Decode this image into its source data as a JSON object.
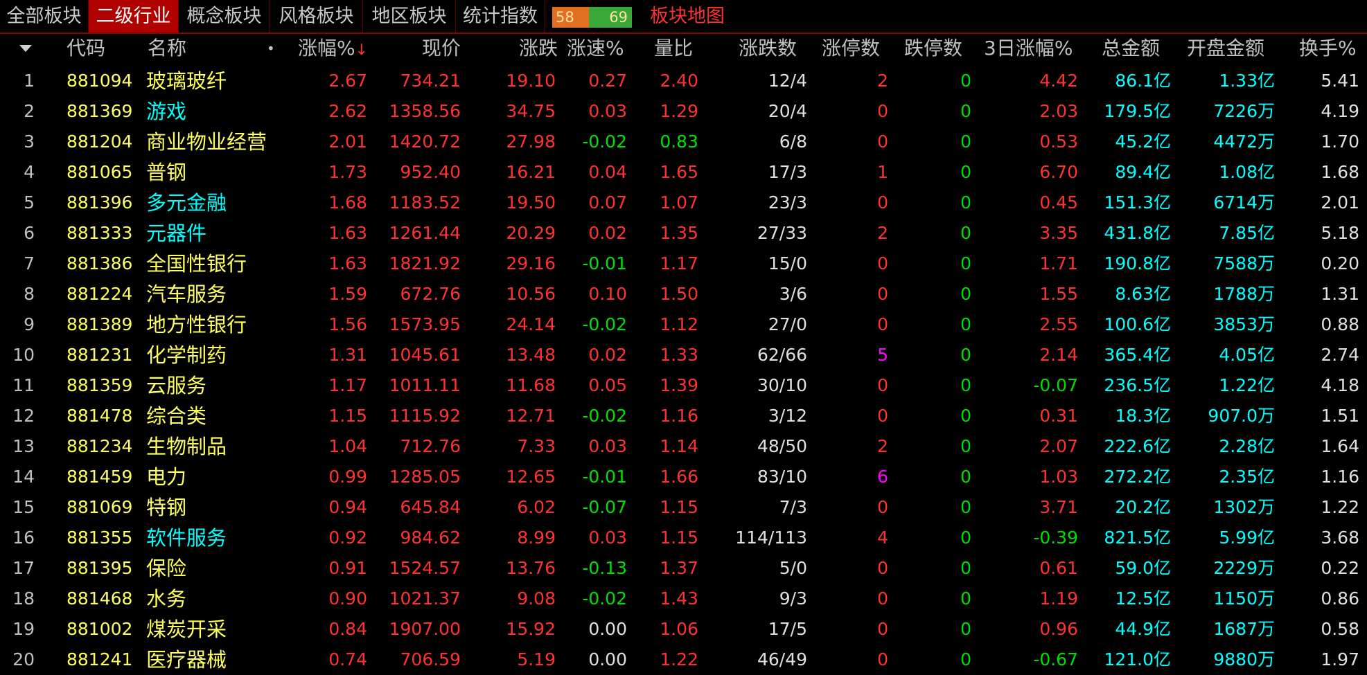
{
  "tabs": [
    {
      "label": "全部板块",
      "active": false
    },
    {
      "label": "二级行业",
      "active": true
    },
    {
      "label": "概念板块",
      "active": false
    },
    {
      "label": "风格板块",
      "active": false
    },
    {
      "label": "地区板块",
      "active": false
    },
    {
      "label": "统计指数",
      "active": false
    }
  ],
  "ratio": {
    "up": "58",
    "down": "69",
    "up_fraction": 0.457
  },
  "map_label": "板块地图",
  "headers": {
    "code": "代码",
    "name": "名称",
    "dot": "•",
    "pct": "涨幅%",
    "pct_sort": "↓",
    "price": "现价",
    "change": "涨跌",
    "speed": "涨速%",
    "vol_ratio": "量比",
    "updown": "涨跌数",
    "limit_up": "涨停数",
    "limit_down": "跌停数",
    "pct3": "3日涨幅%",
    "amount": "总金额",
    "open_amount": "开盘金额",
    "turnover": "换手%"
  },
  "colors": {
    "red": "#ff3232",
    "green": "#00e000",
    "cyan": "#00ffff",
    "yellow": "#ffff60",
    "tab_active": "#b00000"
  },
  "rows": [
    {
      "idx": "1",
      "code": "881094",
      "name": "玻璃玻纤",
      "name_color": "yellow",
      "pct": "2.67",
      "price": "734.21",
      "change": "19.10",
      "speed": "0.27",
      "vol_ratio": "2.40",
      "updown": "12/4",
      "limit_up": "2",
      "limit_up_color": "red",
      "limit_down": "0",
      "pct3": "4.42",
      "amount": "86.1亿",
      "open_amount": "1.33亿",
      "turnover": "5.41"
    },
    {
      "idx": "2",
      "code": "881369",
      "name": "游戏",
      "name_color": "cyan",
      "pct": "2.62",
      "price": "1358.56",
      "change": "34.75",
      "speed": "0.03",
      "vol_ratio": "1.29",
      "updown": "20/4",
      "limit_up": "0",
      "limit_up_color": "red",
      "limit_down": "0",
      "pct3": "2.03",
      "amount": "179.5亿",
      "open_amount": "7226万",
      "turnover": "4.19"
    },
    {
      "idx": "3",
      "code": "881204",
      "name": "商业物业经营",
      "name_color": "yellow",
      "pct": "2.01",
      "price": "1420.72",
      "change": "27.98",
      "speed": "-0.02",
      "vol_ratio": "0.83",
      "updown": "6/8",
      "limit_up": "0",
      "limit_up_color": "red",
      "limit_down": "0",
      "pct3": "0.53",
      "amount": "45.2亿",
      "open_amount": "4472万",
      "turnover": "1.70"
    },
    {
      "idx": "4",
      "code": "881065",
      "name": "普钢",
      "name_color": "yellow",
      "pct": "1.73",
      "price": "952.40",
      "change": "16.21",
      "speed": "0.04",
      "vol_ratio": "1.65",
      "updown": "17/3",
      "limit_up": "1",
      "limit_up_color": "red",
      "limit_down": "0",
      "pct3": "6.70",
      "amount": "89.4亿",
      "open_amount": "1.08亿",
      "turnover": "1.68"
    },
    {
      "idx": "5",
      "code": "881396",
      "name": "多元金融",
      "name_color": "cyan",
      "pct": "1.68",
      "price": "1183.52",
      "change": "19.50",
      "speed": "0.07",
      "vol_ratio": "1.07",
      "updown": "23/3",
      "limit_up": "0",
      "limit_up_color": "red",
      "limit_down": "0",
      "pct3": "0.45",
      "amount": "151.3亿",
      "open_amount": "6714万",
      "turnover": "2.01"
    },
    {
      "idx": "6",
      "code": "881333",
      "name": "元器件",
      "name_color": "cyan",
      "pct": "1.63",
      "price": "1261.44",
      "change": "20.29",
      "speed": "0.02",
      "vol_ratio": "1.35",
      "updown": "27/33",
      "limit_up": "2",
      "limit_up_color": "red",
      "limit_down": "0",
      "pct3": "3.35",
      "amount": "431.8亿",
      "open_amount": "7.85亿",
      "turnover": "5.18"
    },
    {
      "idx": "7",
      "code": "881386",
      "name": "全国性银行",
      "name_color": "yellow",
      "pct": "1.63",
      "price": "1821.92",
      "change": "29.16",
      "speed": "-0.01",
      "vol_ratio": "1.17",
      "updown": "15/0",
      "limit_up": "0",
      "limit_up_color": "red",
      "limit_down": "0",
      "pct3": "1.71",
      "amount": "190.8亿",
      "open_amount": "7588万",
      "turnover": "0.20"
    },
    {
      "idx": "8",
      "code": "881224",
      "name": "汽车服务",
      "name_color": "yellow",
      "pct": "1.59",
      "price": "672.76",
      "change": "10.56",
      "speed": "0.10",
      "vol_ratio": "1.50",
      "updown": "3/6",
      "limit_up": "0",
      "limit_up_color": "red",
      "limit_down": "0",
      "pct3": "1.55",
      "amount": "8.63亿",
      "open_amount": "1788万",
      "turnover": "1.31"
    },
    {
      "idx": "9",
      "code": "881389",
      "name": "地方性银行",
      "name_color": "yellow",
      "pct": "1.56",
      "price": "1573.95",
      "change": "24.14",
      "speed": "-0.02",
      "vol_ratio": "1.12",
      "updown": "27/0",
      "limit_up": "0",
      "limit_up_color": "red",
      "limit_down": "0",
      "pct3": "2.55",
      "amount": "100.6亿",
      "open_amount": "3853万",
      "turnover": "0.88"
    },
    {
      "idx": "10",
      "code": "881231",
      "name": "化学制药",
      "name_color": "yellow",
      "pct": "1.31",
      "price": "1045.61",
      "change": "13.48",
      "speed": "0.02",
      "vol_ratio": "1.33",
      "updown": "62/66",
      "limit_up": "5",
      "limit_up_color": "magenta",
      "limit_down": "0",
      "pct3": "2.14",
      "amount": "365.4亿",
      "open_amount": "4.05亿",
      "turnover": "2.74"
    },
    {
      "idx": "11",
      "code": "881359",
      "name": "云服务",
      "name_color": "yellow",
      "pct": "1.17",
      "price": "1011.11",
      "change": "11.68",
      "speed": "0.05",
      "vol_ratio": "1.39",
      "updown": "30/10",
      "limit_up": "0",
      "limit_up_color": "red",
      "limit_down": "0",
      "pct3": "-0.07",
      "amount": "236.5亿",
      "open_amount": "1.22亿",
      "turnover": "4.18"
    },
    {
      "idx": "12",
      "code": "881478",
      "name": "综合类",
      "name_color": "yellow",
      "pct": "1.15",
      "price": "1115.92",
      "change": "12.71",
      "speed": "-0.02",
      "vol_ratio": "1.16",
      "updown": "3/12",
      "limit_up": "0",
      "limit_up_color": "red",
      "limit_down": "0",
      "pct3": "0.31",
      "amount": "18.3亿",
      "open_amount": "907.0万",
      "turnover": "1.51"
    },
    {
      "idx": "13",
      "code": "881234",
      "name": "生物制品",
      "name_color": "yellow",
      "pct": "1.04",
      "price": "712.76",
      "change": "7.33",
      "speed": "0.03",
      "vol_ratio": "1.14",
      "updown": "48/50",
      "limit_up": "2",
      "limit_up_color": "red",
      "limit_down": "0",
      "pct3": "2.07",
      "amount": "222.6亿",
      "open_amount": "2.28亿",
      "turnover": "1.64"
    },
    {
      "idx": "14",
      "code": "881459",
      "name": "电力",
      "name_color": "yellow",
      "pct": "0.99",
      "price": "1285.05",
      "change": "12.65",
      "speed": "-0.01",
      "vol_ratio": "1.66",
      "updown": "83/10",
      "limit_up": "6",
      "limit_up_color": "magenta",
      "limit_down": "0",
      "pct3": "1.03",
      "amount": "272.2亿",
      "open_amount": "2.35亿",
      "turnover": "1.16"
    },
    {
      "idx": "15",
      "code": "881069",
      "name": "特钢",
      "name_color": "yellow",
      "pct": "0.94",
      "price": "645.84",
      "change": "6.02",
      "speed": "-0.07",
      "vol_ratio": "1.15",
      "updown": "7/3",
      "limit_up": "0",
      "limit_up_color": "red",
      "limit_down": "0",
      "pct3": "3.71",
      "amount": "20.2亿",
      "open_amount": "1302万",
      "turnover": "1.22"
    },
    {
      "idx": "16",
      "code": "881355",
      "name": "软件服务",
      "name_color": "cyan",
      "pct": "0.92",
      "price": "984.62",
      "change": "8.99",
      "speed": "0.03",
      "vol_ratio": "1.15",
      "updown": "114/113",
      "limit_up": "4",
      "limit_up_color": "red",
      "limit_down": "0",
      "pct3": "-0.39",
      "amount": "821.5亿",
      "open_amount": "5.99亿",
      "turnover": "3.68"
    },
    {
      "idx": "17",
      "code": "881395",
      "name": "保险",
      "name_color": "yellow",
      "pct": "0.91",
      "price": "1524.57",
      "change": "13.76",
      "speed": "-0.13",
      "vol_ratio": "1.37",
      "updown": "5/0",
      "limit_up": "0",
      "limit_up_color": "red",
      "limit_down": "0",
      "pct3": "0.61",
      "amount": "59.0亿",
      "open_amount": "2229万",
      "turnover": "0.22"
    },
    {
      "idx": "18",
      "code": "881468",
      "name": "水务",
      "name_color": "yellow",
      "pct": "0.90",
      "price": "1021.37",
      "change": "9.08",
      "speed": "-0.02",
      "vol_ratio": "1.43",
      "updown": "9/3",
      "limit_up": "0",
      "limit_up_color": "red",
      "limit_down": "0",
      "pct3": "1.19",
      "amount": "12.5亿",
      "open_amount": "1150万",
      "turnover": "0.86"
    },
    {
      "idx": "19",
      "code": "881002",
      "name": "煤炭开采",
      "name_color": "yellow",
      "pct": "0.84",
      "price": "1907.00",
      "change": "15.92",
      "speed": "0.00",
      "vol_ratio": "1.06",
      "updown": "17/5",
      "limit_up": "0",
      "limit_up_color": "red",
      "limit_down": "0",
      "pct3": "0.96",
      "amount": "44.9亿",
      "open_amount": "1687万",
      "turnover": "0.58"
    },
    {
      "idx": "20",
      "code": "881241",
      "name": "医疗器械",
      "name_color": "yellow",
      "pct": "0.74",
      "price": "706.59",
      "change": "5.19",
      "speed": "0.00",
      "vol_ratio": "1.22",
      "updown": "46/49",
      "limit_up": "0",
      "limit_up_color": "red",
      "limit_down": "0",
      "pct3": "-0.67",
      "amount": "121.0亿",
      "open_amount": "9880万",
      "turnover": "1.97"
    }
  ]
}
